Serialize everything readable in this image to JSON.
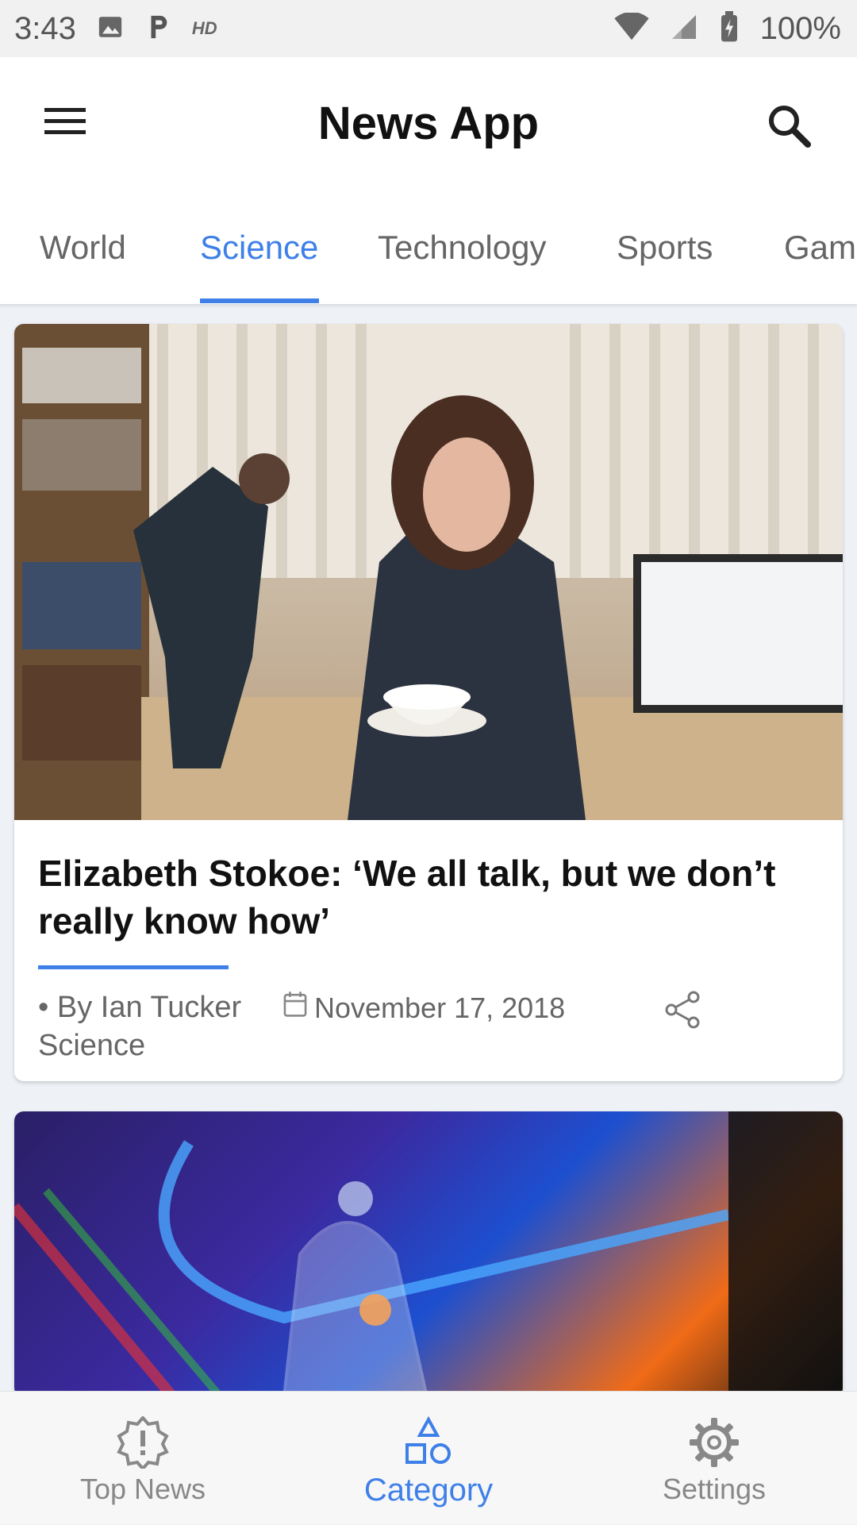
{
  "status_bar": {
    "time": "3:43",
    "hd_label": "HD",
    "battery": "100%"
  },
  "app_bar": {
    "title": "News App"
  },
  "tabs": [
    {
      "label": "World"
    },
    {
      "label": "Science",
      "active": true
    },
    {
      "label": "Technology"
    },
    {
      "label": "Sports"
    },
    {
      "label": "Gam"
    }
  ],
  "articles": [
    {
      "title": "Elizabeth Stokoe: ‘We all talk, but we don’t really know how’",
      "author": "• By Ian Tucker",
      "category": "Science",
      "date": "November 17, 2018",
      "image": "photo-woman-with-cup"
    },
    {
      "image": "photo-glass-bell-jar"
    }
  ],
  "bottom_nav": [
    {
      "label": "Top News",
      "icon": "alert-badge-icon"
    },
    {
      "label": "Category",
      "icon": "shapes-icon",
      "active": true
    },
    {
      "label": "Settings",
      "icon": "gear-icon"
    }
  ],
  "colors": {
    "accent": "#3f80e8",
    "background": "#eef1f6"
  }
}
